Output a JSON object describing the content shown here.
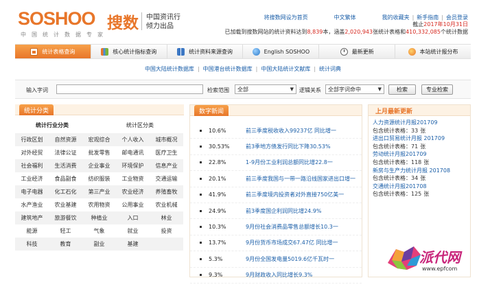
{
  "header": {
    "logo_text": "SOSHOO",
    "logo_cn": "搜数",
    "logo_subtitle": "中国统计数据专家",
    "slogan_line1": "中国资讯行",
    "slogan_line2": "倾力出品",
    "links": {
      "set_home": "将搜数网设为首页",
      "traditional": "中文繁体",
      "favorites": "我的收藏夹",
      "guide": "新手指南",
      "member_login": "会员登录",
      "divider": "|"
    },
    "date_prefix": "截止",
    "date_value": "2017年10月31日",
    "stats_prefix": "已加载到搜数网站的统计资料达到",
    "stats_docs": "8,839",
    "stats_mid1": "本，涵盖",
    "stats_tables": "2,020,943",
    "stats_mid2": "张统计表格和",
    "stats_items": "410,332,085",
    "stats_suffix": "个统计数据"
  },
  "nav": {
    "items": [
      {
        "label": "统计表格查询",
        "icon": "home-icon"
      },
      {
        "label": "核心统计指标查询",
        "icon": "chart-icon"
      },
      {
        "label": "统计资料来源查询",
        "icon": "book-icon"
      },
      {
        "label": "English SOSHOO",
        "icon": "globe-icon"
      },
      {
        "label": "最新更新",
        "icon": "clock-icon"
      },
      {
        "label": "本站统计报分布",
        "icon": "pin-icon"
      }
    ]
  },
  "subnav": {
    "items": [
      "中国大陆统计数据库",
      "中国港台统计数据库",
      "中国大陆统计文献库",
      "统计词典"
    ],
    "divider": "|"
  },
  "search": {
    "keyword_label": "输入字词",
    "keyword_value": "",
    "scope_label": "检索范围",
    "scope_value": "全部",
    "logic_label": "逻辑关系",
    "logic_value": "全部字词命中",
    "search_button": "检索",
    "advanced_button": "专业检索"
  },
  "categories": {
    "panel_title": "统计分类",
    "industry_header": "统计行业分类",
    "region_header": "统计区分类",
    "items": [
      "行政区划",
      "自然资源",
      "宏观综合",
      "个人收入",
      "城市概况",
      "对外经贸",
      "法律公证",
      "批发零售",
      "邮电通讯",
      "医疗卫生",
      "社会福利",
      "生活消费",
      "企业事业",
      "环境保护",
      "信息产业",
      "工业经济",
      "食品副食",
      "纺织服装",
      "工业物资",
      "交通运输",
      "电子电器",
      "化工石化",
      "第三产业",
      "农业经济",
      "养殖畜牧",
      "水产渔业",
      "农业基建",
      "农用物资",
      "公用事业",
      "农业机械",
      "建筑地产",
      "旅游餐饮",
      "种植业",
      "入口",
      "林业",
      "能源",
      "轻工",
      "气象",
      "就业",
      "投资",
      "科技",
      "教育",
      "副业",
      "基建",
      ""
    ]
  },
  "news": {
    "panel_title": "数字新闻",
    "items": [
      {
        "pct": "10.6%",
        "title": "前三季度税收收入99237亿 同比增一"
      },
      {
        "pct": "30.53%",
        "title": "前3季地方债发行同比下降30.53%"
      },
      {
        "pct": "22.8%",
        "title": "1-9月份工业利润总额同比增22.8一"
      },
      {
        "pct": "20.1%",
        "title": "前三季度我国与一带一路沿线国家进出口增一"
      },
      {
        "pct": "41.9%",
        "title": "前三季度境内投资者对外直接750亿美一"
      },
      {
        "pct": "24.9%",
        "title": "前3季度国企利润同比增24.9%"
      },
      {
        "pct": "10.3%",
        "title": "9月份社会消费品零售总额增长10.3一"
      },
      {
        "pct": "13.7%",
        "title": "9月份货币市场成交67.47亿 同比增一"
      },
      {
        "pct": "5.3%",
        "title": "9月份全国发电量5019.6亿千瓦时一"
      },
      {
        "pct": "9.3%",
        "title": "9月财政收入同比增长9.3%"
      }
    ]
  },
  "updates": {
    "panel_title": "上月最新更新",
    "count_prefix": "包含统计表格：",
    "count_suffix": "张",
    "items": [
      {
        "title": "人力资源统计月报201709",
        "count": "33"
      },
      {
        "title": "进出口贸易统计月报 201709",
        "count": "71"
      },
      {
        "title": "劳动统计月报201709",
        "count": "118"
      },
      {
        "title": "新房与生产力统计月报 201708",
        "count": "34"
      },
      {
        "title": "交通统计月报201708",
        "count": "125"
      }
    ]
  },
  "watermark": {
    "brand": "派代网",
    "url": "www.epfcom"
  }
}
